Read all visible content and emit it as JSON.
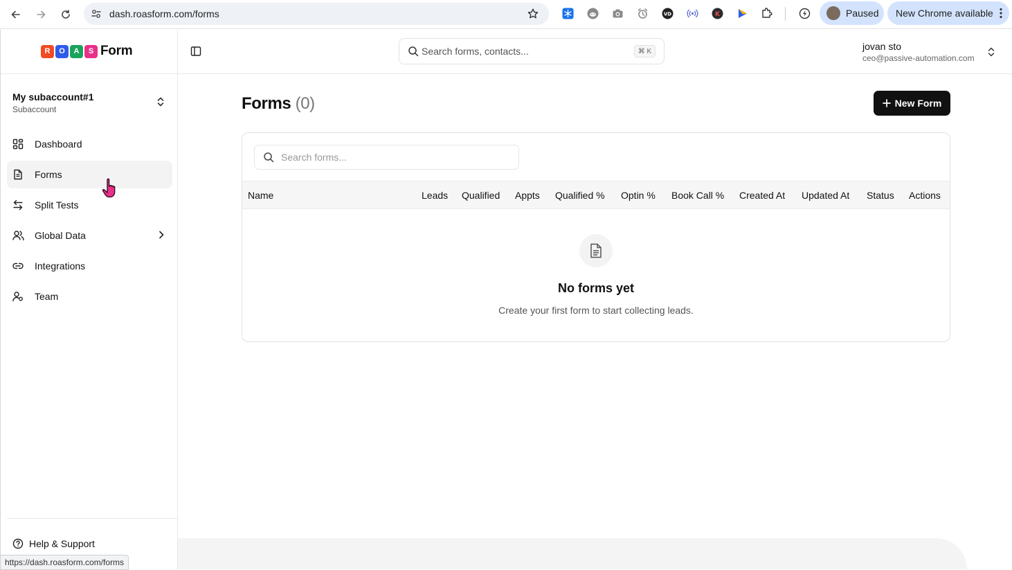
{
  "browser": {
    "url": "dash.roasform.com/forms",
    "profile_status": "Paused",
    "update_label": "New Chrome available",
    "status_url": "https://dash.roasform.com/forms"
  },
  "logo": {
    "tiles": [
      "R",
      "O",
      "A",
      "S"
    ],
    "tile_colors": [
      "#f04b23",
      "#2f5bea",
      "#19a35b",
      "#e8308a"
    ],
    "word": "Form"
  },
  "account": {
    "name": "My subaccount#1",
    "type": "Subaccount"
  },
  "sidebar": {
    "items": [
      {
        "label": "Dashboard",
        "icon": "dashboard-grid-icon"
      },
      {
        "label": "Forms",
        "icon": "document-icon",
        "active": true
      },
      {
        "label": "Split Tests",
        "icon": "arrows-swap-icon"
      },
      {
        "label": "Global Data",
        "icon": "users-icon",
        "has_submenu": true
      },
      {
        "label": "Integrations",
        "icon": "link-icon"
      },
      {
        "label": "Team",
        "icon": "user-team-icon"
      }
    ],
    "help_label": "Help & Support"
  },
  "topbar": {
    "search_placeholder": "Search forms, contacts...",
    "shortcut": "⌘ K",
    "user_name": "jovan sto",
    "user_email": "ceo@passive-automation.com"
  },
  "page": {
    "title": "Forms",
    "count": "(0)",
    "new_form_label": "New Form"
  },
  "table": {
    "search_placeholder": "Search forms...",
    "columns": [
      "Name",
      "Leads",
      "Qualified",
      "Appts",
      "Qualified %",
      "Optin %",
      "Book Call %",
      "Created At",
      "Updated At",
      "Status",
      "Actions"
    ],
    "empty_title": "No forms yet",
    "empty_subtitle": "Create your first form to start collecting leads."
  },
  "colors": {
    "accent": "#111111",
    "active_nav_bg": "#f3f3f4",
    "chrome_pill": "#d3e3fd"
  }
}
